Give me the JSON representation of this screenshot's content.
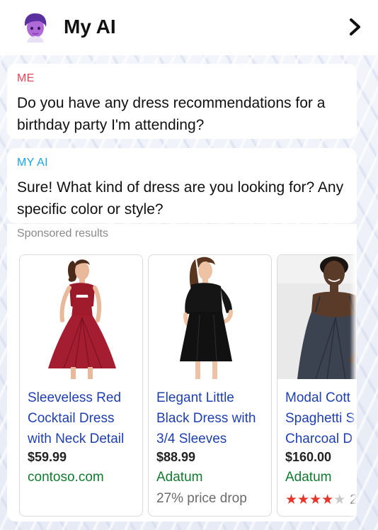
{
  "header": {
    "title": "My AI",
    "avatar_icon": "bitmoji-avatar-icon",
    "nav_icon": "chevron-right-icon"
  },
  "messages": [
    {
      "sender": "ME",
      "text": "Do you have any dress recommendations for a birthday party I'm attending?"
    },
    {
      "sender": "MY AI",
      "text": "Sure! What kind of dress are you looking for? Any specific color or style?"
    }
  ],
  "sponsored": {
    "label": "Sponsored results",
    "products": [
      {
        "name": "Sleeveless Red Cocktail Dress with Neck Detail",
        "price": "$59.99",
        "seller": "contoso.com",
        "note": "",
        "image_icon": "red-dress-photo"
      },
      {
        "name": "Elegant Little Black Dress with 3/4 Sleeves",
        "price": "$88.99",
        "seller": "Adatum",
        "note": "27% price drop",
        "image_icon": "black-dress-photo"
      },
      {
        "name_lines": [
          "Modal Cott",
          "Spaghetti S",
          "Charcoal D"
        ],
        "price": "$160.00",
        "seller": "Adatum",
        "rating": 4,
        "rating_count": "2",
        "image_icon": "charcoal-dress-photo"
      }
    ]
  },
  "colors": {
    "me_label": "#e8455a",
    "ai_label": "#1aa4e3",
    "link_blue": "#1f3fb0",
    "seller_green": "#117a2e",
    "star_red": "#e8342a"
  }
}
